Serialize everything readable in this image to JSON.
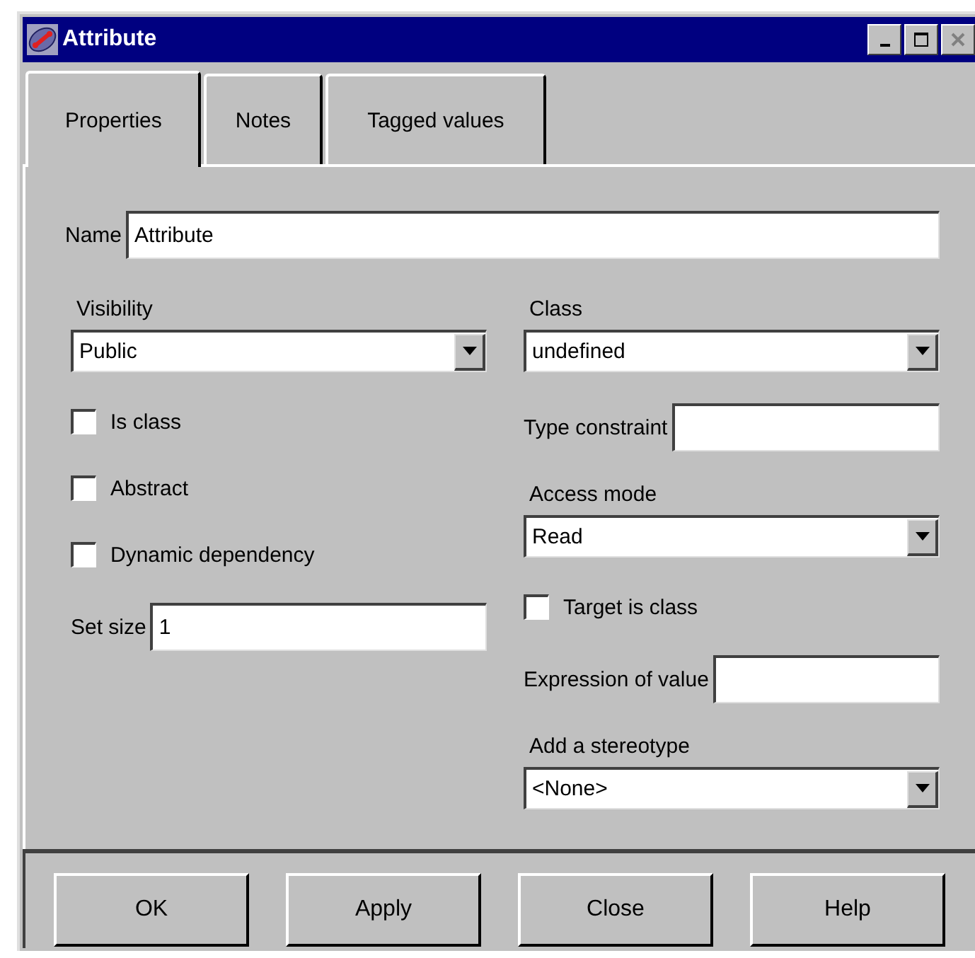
{
  "window": {
    "title": "Attribute"
  },
  "tabs": [
    {
      "label": "Properties",
      "selected": true
    },
    {
      "label": "Notes",
      "selected": false
    },
    {
      "label": "Tagged values",
      "selected": false
    }
  ],
  "name_field": {
    "label": "Name",
    "value": "Attribute"
  },
  "left_column": [
    {
      "kind": "combo",
      "label": "Visibility",
      "value": "Public"
    },
    {
      "kind": "checkbox",
      "label": "Is class",
      "checked": false
    },
    {
      "kind": "checkbox",
      "label": "Abstract",
      "checked": false
    },
    {
      "kind": "checkbox",
      "label": "Dynamic dependency",
      "checked": false
    },
    {
      "kind": "field",
      "label": "Set size",
      "value": "1"
    }
  ],
  "right_column": [
    {
      "kind": "combo",
      "label": "Class",
      "value": "undefined"
    },
    {
      "kind": "field",
      "label": "Type constraint"
    },
    {
      "kind": "combo",
      "label": "Access mode",
      "value": "Read"
    },
    {
      "kind": "checkbox",
      "label": "Target is class",
      "checked": false
    },
    {
      "kind": "field",
      "label": "Expression of value"
    },
    {
      "kind": "combo",
      "label": "Add a stereotype",
      "value": "<None>"
    }
  ],
  "buttons": [
    "OK",
    "Apply",
    "Close",
    "Help"
  ]
}
